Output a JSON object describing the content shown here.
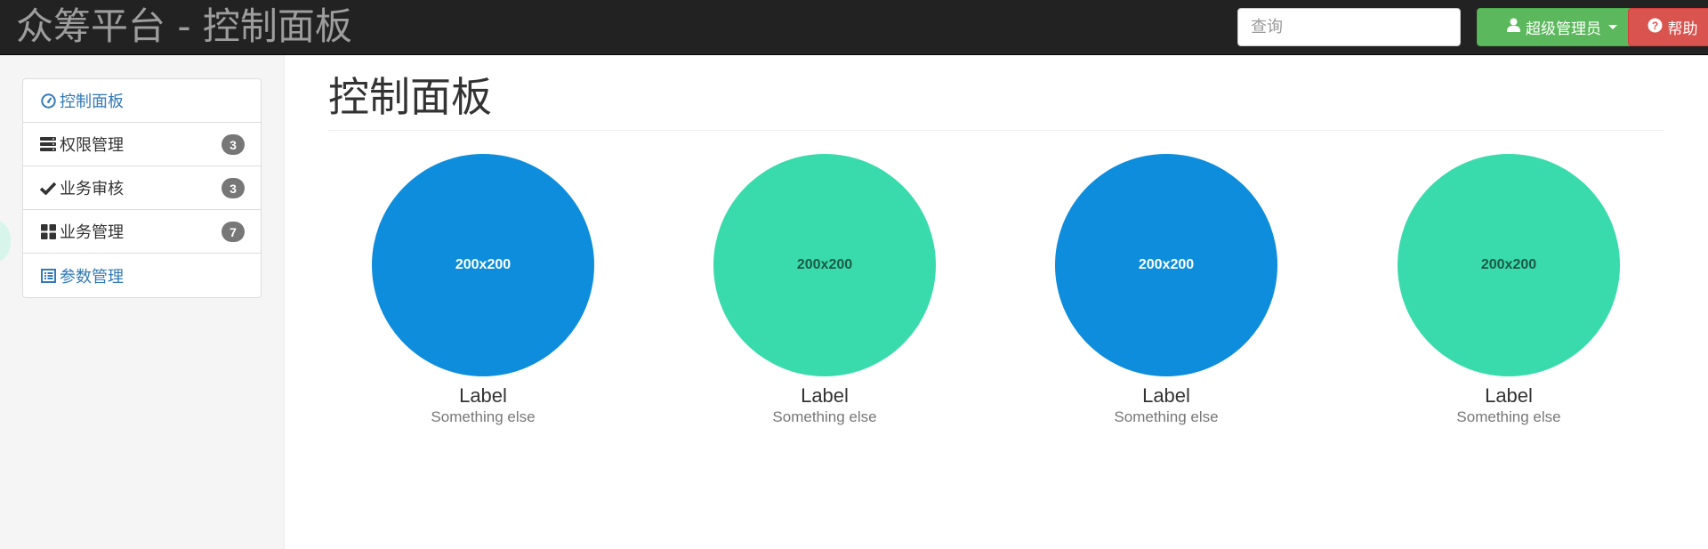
{
  "navbar": {
    "brand": "众筹平台 - 控制面板",
    "search_placeholder": "查询",
    "admin_label": "超级管理员",
    "help_label": "帮助"
  },
  "sidebar": {
    "items": [
      {
        "label": "控制面板",
        "icon": "dashboard-icon"
      },
      {
        "label": "权限管理",
        "icon": "server-icon",
        "badge": "3"
      },
      {
        "label": "业务审核",
        "icon": "checkmark-icon",
        "badge": "3"
      },
      {
        "label": "业务管理",
        "icon": "grid-icon",
        "badge": "7"
      },
      {
        "label": "参数管理",
        "icon": "list-alt-icon"
      }
    ]
  },
  "main": {
    "title": "控制面板",
    "tiles": [
      {
        "placeholder": "200x200",
        "label": "Label",
        "sub": "Something else",
        "color": "#0d8ddb"
      },
      {
        "placeholder": "200x200",
        "label": "Label",
        "sub": "Something else",
        "color": "#39dbac"
      },
      {
        "placeholder": "200x200",
        "label": "Label",
        "sub": "Something else",
        "color": "#0d8ddb"
      },
      {
        "placeholder": "200x200",
        "label": "Label",
        "sub": "Something else",
        "color": "#39dbac"
      }
    ]
  },
  "colors": {
    "navbar_bg": "#222222",
    "admin_button": "#5cb85c",
    "help_button": "#d9534f",
    "link": "#337ab7",
    "badge": "#777777"
  }
}
